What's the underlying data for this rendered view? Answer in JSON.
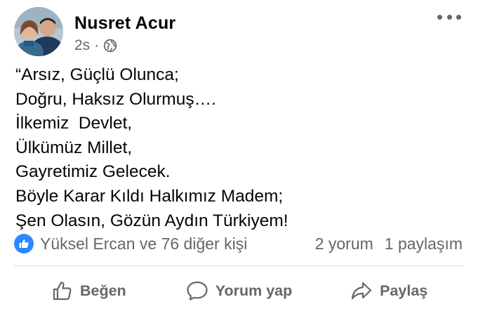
{
  "post": {
    "author": "Nusret Acur",
    "time": "2s",
    "separator": "·",
    "privacy_icon": "globe-icon",
    "more_icon": "ellipsis-icon",
    "lines": [
      "“Arsız, Güçlü Olunca;",
      "Doğru, Haksız Olurmuş….",
      "İlkemiz  Devlet,",
      "Ülkümüz Millet,",
      "Gayretimiz Gelecek.",
      "Böyle Karar Kıldı Halkımız Madem;",
      "Şen Olasın, Gözün Aydın Türkiyem!"
    ]
  },
  "stats": {
    "reaction_icon": "like-reaction-icon",
    "reactions": "Yüksel Ercan ve 76 diğer kişi",
    "comments": "2 yorum",
    "shares": "1 paylaşım"
  },
  "actions": {
    "like": "Beğen",
    "comment": "Yorum yap",
    "share": "Paylaş"
  },
  "colors": {
    "accent": "#2d88ff",
    "secondary_text": "#65676b",
    "divider": "#dadde1"
  }
}
